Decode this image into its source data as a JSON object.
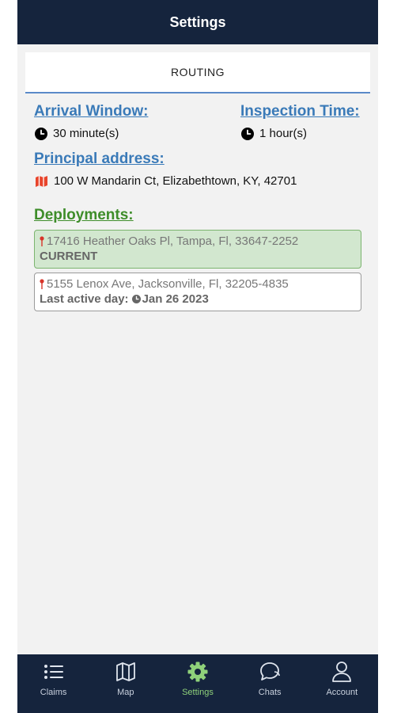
{
  "header": {
    "title": "Settings"
  },
  "tab": {
    "label": "ROUTING"
  },
  "arrival": {
    "title": "Arrival Window:",
    "value": "30 minute(s)"
  },
  "inspection": {
    "title": "Inspection Time:",
    "value": "1 hour(s)"
  },
  "principal": {
    "title": "Principal address:",
    "value": "100 W Mandarin Ct, Elizabethtown, KY, 42701"
  },
  "deployments": {
    "title": "Deployments:",
    "items": [
      {
        "address": "17416 Heather Oaks Pl, Tampa, Fl, 33647-2252",
        "status": "CURRENT"
      },
      {
        "address": "5155 Lenox Ave, Jacksonville, Fl, 32205-4835",
        "last_label": "Last active day:",
        "last_date": "Jan 26 2023"
      }
    ]
  },
  "nav": [
    {
      "label": "Claims",
      "icon": "list-icon"
    },
    {
      "label": "Map",
      "icon": "map-icon"
    },
    {
      "label": "Settings",
      "icon": "gear-icon",
      "active": true
    },
    {
      "label": "Chats",
      "icon": "chat-icon"
    },
    {
      "label": "Account",
      "icon": "person-icon"
    }
  ],
  "colors": {
    "header": "#15243d",
    "accent_blue": "#3a7ab8",
    "accent_green": "#3e8d2a",
    "active_nav": "#8fd17a"
  }
}
